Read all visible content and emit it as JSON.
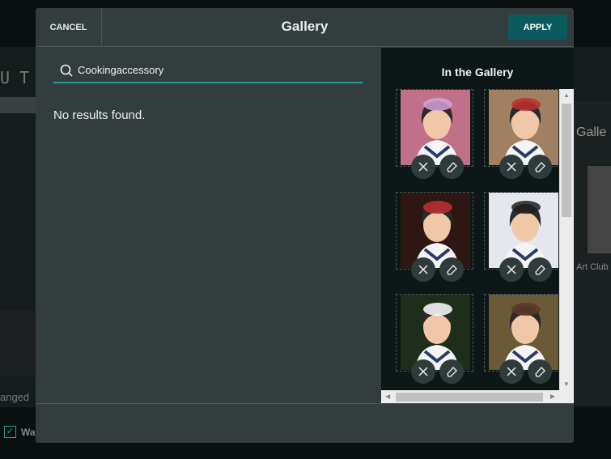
{
  "background": {
    "toolbar_glyphs": "U  T",
    "gallery_label": "Galle",
    "art_club_label": "Art Club",
    "changed_label": "anged",
    "checkbox_label": "Wat"
  },
  "dialog": {
    "cancel_label": "CANCEL",
    "title": "Gallery",
    "apply_label": "APPLY"
  },
  "search": {
    "value": "Cookingaccessory",
    "icon": "search-icon"
  },
  "results": {
    "empty_message": "No results found."
  },
  "gallery": {
    "title": "In the Gallery",
    "items": [
      {
        "bg": "#c07088",
        "accent": "#d6a0d8"
      },
      {
        "bg": "#a08060",
        "accent": "#c03030"
      },
      {
        "bg": "#2e1612",
        "accent": "#c03030"
      },
      {
        "bg": "#e4e8ee",
        "accent": "#202020"
      },
      {
        "bg": "#1e2e1a",
        "accent": "#ffffff"
      },
      {
        "bg": "#6a5a38",
        "accent": "#5a3a28"
      }
    ]
  },
  "colors": {
    "accent": "#0b5a5e",
    "underline": "#2a9a95"
  }
}
